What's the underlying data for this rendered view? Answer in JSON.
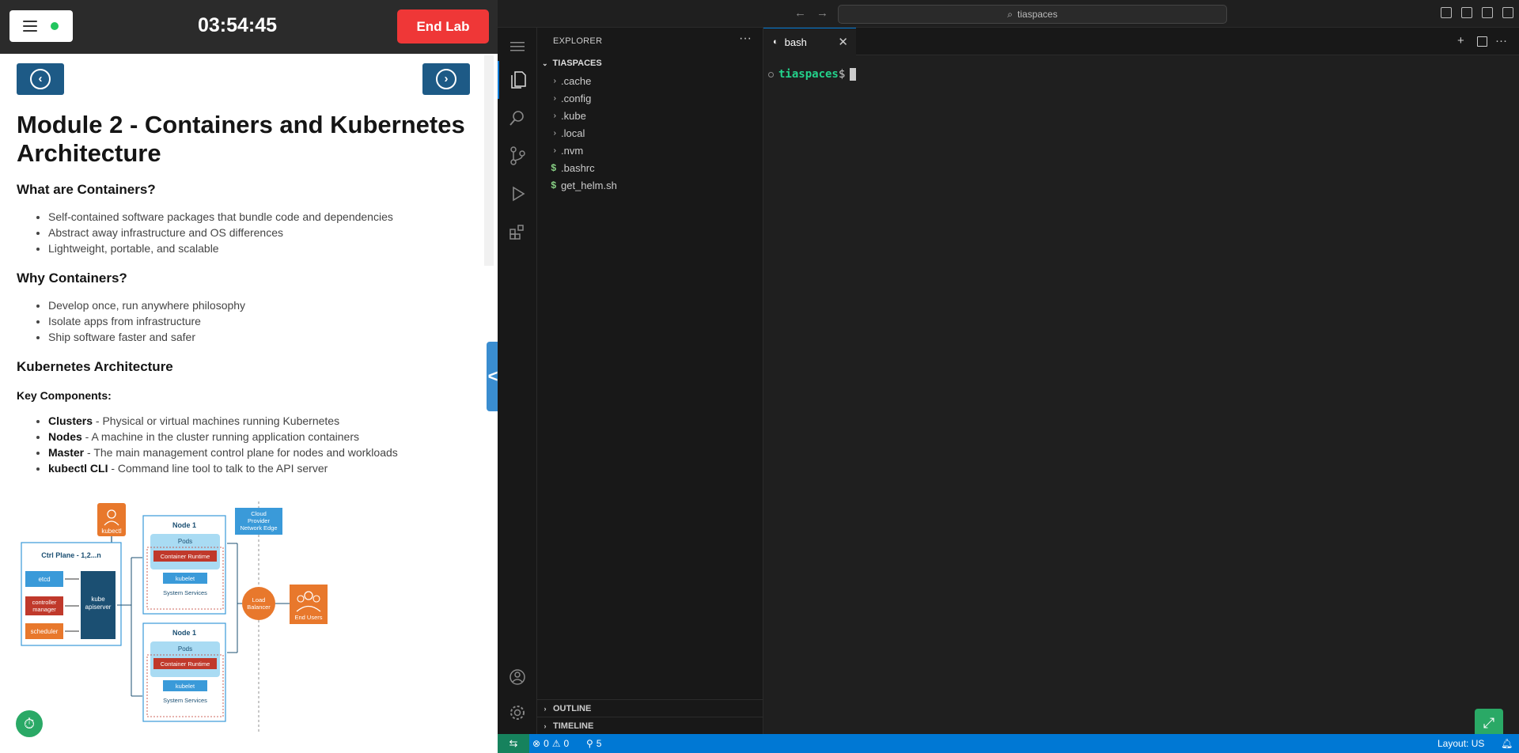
{
  "lab": {
    "timer": "03:54:45",
    "end_lab_label": "End Lab",
    "title": "Module 2 - Containers and Kubernetes Architecture",
    "sections": {
      "what": {
        "heading": "What are Containers?",
        "bullets": [
          "Self-contained software packages that bundle code and dependencies",
          "Abstract away infrastructure and OS differences",
          "Lightweight, portable, and scalable"
        ]
      },
      "why": {
        "heading": "Why Containers?",
        "bullets": [
          "Develop once, run anywhere philosophy",
          "Isolate apps from infrastructure",
          "Ship software faster and safer"
        ]
      },
      "k8s": {
        "heading": "Kubernetes Architecture",
        "subheading": "Key Components:",
        "items": [
          {
            "term": "Clusters",
            "desc": " - Physical or virtual machines running Kubernetes"
          },
          {
            "term": "Nodes",
            "desc": " - A machine in the cluster running application containers"
          },
          {
            "term": "Master",
            "desc": " - The main management control plane for nodes and workloads"
          },
          {
            "term": "kubectl CLI",
            "desc": " - Command line tool to talk to the API server"
          }
        ]
      }
    },
    "diagram": {
      "kubectl": "kubectl",
      "ctrl_plane": "Ctrl Plane - 1,2...n",
      "etcd": "etcd",
      "controller_manager": [
        "controller",
        "manager"
      ],
      "scheduler": "scheduler",
      "apiserver": [
        "kube",
        "apiserver"
      ],
      "node_title": "Node 1",
      "pods": "Pods",
      "container_runtime": "Container Runtime",
      "kubelet": "kubelet",
      "system_services": "System Services",
      "cloud_edge": [
        "Cloud",
        "Provider",
        "Network Edge"
      ],
      "load_balancer": [
        "Load",
        "Balancer"
      ],
      "end_users": "End Users",
      "colors": {
        "orange": "#e8782c",
        "blue": "#3a9ad9",
        "navy": "#1b4f72",
        "red": "#c0392b",
        "light": "#a9dbf3"
      }
    }
  },
  "vscode": {
    "command_center": "tiaspaces",
    "explorer_title": "EXPLORER",
    "workspace_title": "TIASPACES",
    "folders": [
      ".cache",
      ".config",
      ".kube",
      ".local",
      ".nvm"
    ],
    "files": [
      ".bashrc",
      "get_helm.sh"
    ],
    "outline_label": "OUTLINE",
    "timeline_label": "TIMELINE",
    "tab_label": "bash",
    "terminal": {
      "prompt": "tiaspaces",
      "symbol": "$"
    },
    "status": {
      "errors": "0",
      "warnings": "0",
      "ports": "5",
      "layout": "Layout: US"
    }
  }
}
